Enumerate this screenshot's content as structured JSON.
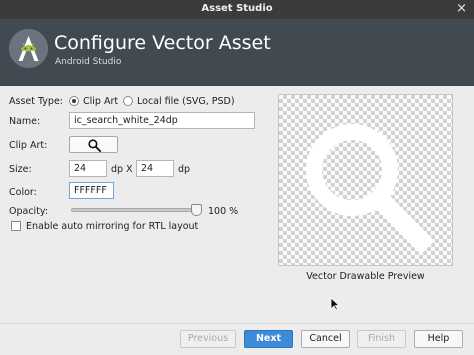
{
  "window": {
    "title": "Asset Studio",
    "close_glyph": "×"
  },
  "header": {
    "title": "Configure Vector Asset",
    "subtitle": "Android Studio",
    "logo_icon": "android-studio-icon"
  },
  "form": {
    "asset_type_label": "Asset Type:",
    "asset_type_options": [
      {
        "label": "Clip Art",
        "selected": true
      },
      {
        "label": "Local file (SVG, PSD)",
        "selected": false
      }
    ],
    "name_label": "Name:",
    "name_value": "ic_search_white_24dp",
    "clip_art_label": "Clip Art:",
    "clip_art_icon": "search-icon",
    "size_label": "Size:",
    "width_value": "24",
    "height_value": "24",
    "unit_dp": "dp",
    "size_separator": "X",
    "color_label": "Color:",
    "color_value": "FFFFFF",
    "opacity_label": "Opacity:",
    "opacity_value": 100,
    "opacity_text": "100 %",
    "rtl_label": "Enable auto mirroring for RTL layout",
    "rtl_checked": false
  },
  "preview": {
    "caption": "Vector Drawable Preview",
    "icon": "search-icon",
    "icon_color": "#FFFFFF"
  },
  "footer": {
    "previous": "Previous",
    "next": "Next",
    "cancel": "Cancel",
    "finish": "Finish",
    "help": "Help"
  },
  "colors": {
    "title_bar": "#3B3B3B",
    "header_bg": "#424A51",
    "primary_button": "#3D8AD9",
    "focus_border": "#6EA3DC"
  }
}
